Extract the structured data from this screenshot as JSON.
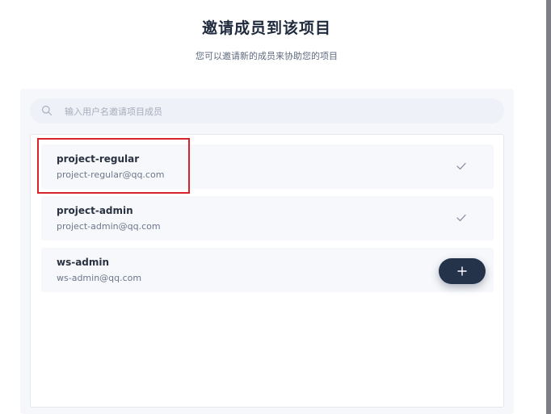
{
  "header": {
    "title": "邀请成员到该项目",
    "subtitle": "您可以邀请新的成员来协助您的项目"
  },
  "search": {
    "placeholder": "输入用户名邀请项目成员",
    "value": ""
  },
  "members": [
    {
      "name": "project-regular",
      "email": "project-regular@qq.com",
      "status": "invited",
      "action_icon": "check-icon"
    },
    {
      "name": "project-admin",
      "email": "project-admin@qq.com",
      "status": "invited",
      "action_icon": "check-icon"
    },
    {
      "name": "ws-admin",
      "email": "ws-admin@qq.com",
      "status": "not-invited",
      "action_icon": "plus-icon"
    }
  ],
  "colors": {
    "title": "#1f2a3d",
    "add_button": "#24324a",
    "highlight_border": "#d8232a",
    "panel_background": "#f5f7fb",
    "member_background": "#f6f8fb"
  },
  "icons": {
    "search": "search-icon",
    "check": "check-icon",
    "add": "plus-icon"
  }
}
